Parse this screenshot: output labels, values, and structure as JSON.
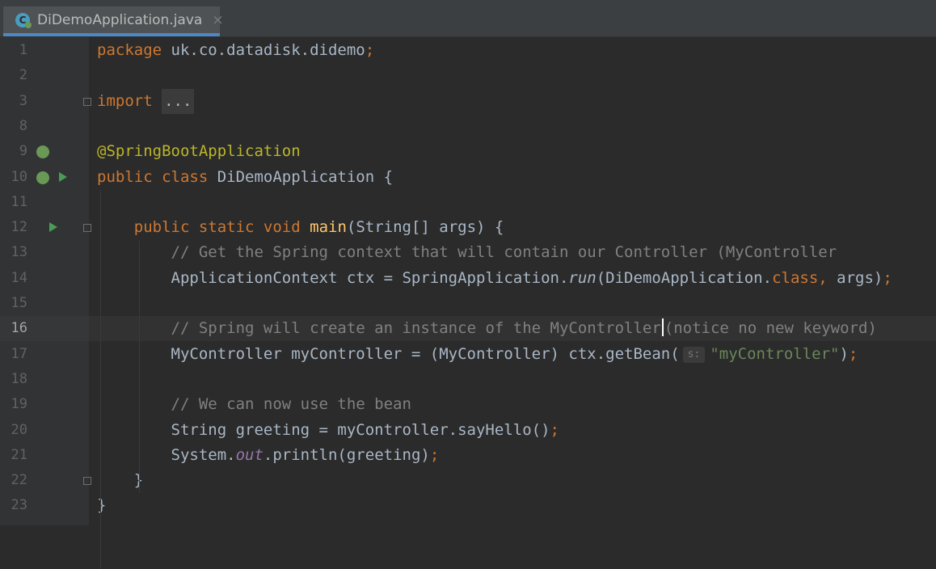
{
  "tab": {
    "title": "DiDemoApplication.java",
    "close_glyph": "×",
    "icon": "java-class-icon"
  },
  "lines": [
    {
      "n": "1",
      "segments": [
        [
          "kw",
          "package"
        ],
        [
          "t",
          " uk.co.datadisk.didemo"
        ],
        [
          "kw",
          ";"
        ]
      ]
    },
    {
      "n": "2",
      "segments": []
    },
    {
      "n": "3",
      "segments": [
        [
          "kw",
          "import"
        ],
        [
          "t",
          " "
        ],
        [
          "fold",
          "..."
        ]
      ]
    },
    {
      "n": "8",
      "segments": []
    },
    {
      "n": "9",
      "segments": [
        [
          "ann",
          "@SpringBootApplication"
        ]
      ]
    },
    {
      "n": "10",
      "segments": [
        [
          "kw",
          "public class"
        ],
        [
          "t",
          " DiDemoApplication {"
        ]
      ]
    },
    {
      "n": "11",
      "segments": []
    },
    {
      "n": "12",
      "segments": [
        [
          "t",
          "    "
        ],
        [
          "kw",
          "public static void"
        ],
        [
          "t",
          " "
        ],
        [
          "fn",
          "main"
        ],
        [
          "t",
          "(String[] args) {"
        ]
      ]
    },
    {
      "n": "13",
      "segments": [
        [
          "t",
          "        "
        ],
        [
          "cm",
          "// Get the Spring context that will contain our Controller (MyController"
        ]
      ]
    },
    {
      "n": "14",
      "segments": [
        [
          "t",
          "        ApplicationContext ctx = SpringApplication."
        ],
        [
          "it",
          "run"
        ],
        [
          "t",
          "(DiDemoApplication."
        ],
        [
          "kw",
          "class"
        ],
        [
          "kw",
          ","
        ],
        [
          "t",
          " args)"
        ],
        [
          "kw",
          ";"
        ]
      ]
    },
    {
      "n": "15",
      "segments": []
    },
    {
      "n": "16",
      "segments": [
        [
          "t",
          "        "
        ],
        [
          "cm",
          "// Spring will create an instance of the MyController"
        ],
        [
          "caret",
          ""
        ],
        [
          "cm",
          "(notice no new keyword)"
        ]
      ]
    },
    {
      "n": "17",
      "segments": [
        [
          "t",
          "        MyController myController = (MyController) ctx.getBean("
        ],
        [
          "hint",
          "s:"
        ],
        [
          "str",
          "\"myController\""
        ],
        [
          "t",
          ")"
        ],
        [
          "kw",
          ";"
        ]
      ]
    },
    {
      "n": "18",
      "segments": []
    },
    {
      "n": "19",
      "segments": [
        [
          "t",
          "        "
        ],
        [
          "cm",
          "// We can now use the bean"
        ]
      ]
    },
    {
      "n": "20",
      "segments": [
        [
          "t",
          "        String greeting = myController.sayHello()"
        ],
        [
          "kw",
          ";"
        ]
      ]
    },
    {
      "n": "21",
      "segments": [
        [
          "t",
          "        System."
        ],
        [
          "sf",
          "out"
        ],
        [
          "t",
          ".println(greeting)"
        ],
        [
          "kw",
          ";"
        ]
      ]
    },
    {
      "n": "22",
      "segments": [
        [
          "t",
          "    }"
        ]
      ]
    },
    {
      "n": "23",
      "segments": [
        [
          "t",
          "}"
        ]
      ]
    }
  ],
  "current_line": "16",
  "colors": {
    "keyword": "#cc7832",
    "annotation": "#bbb529",
    "method": "#ffc66d",
    "comment": "#808080",
    "string": "#6a8759",
    "text": "#a9b7c6",
    "run_icon": "#499c54",
    "tab_accent": "#4a88c7"
  }
}
